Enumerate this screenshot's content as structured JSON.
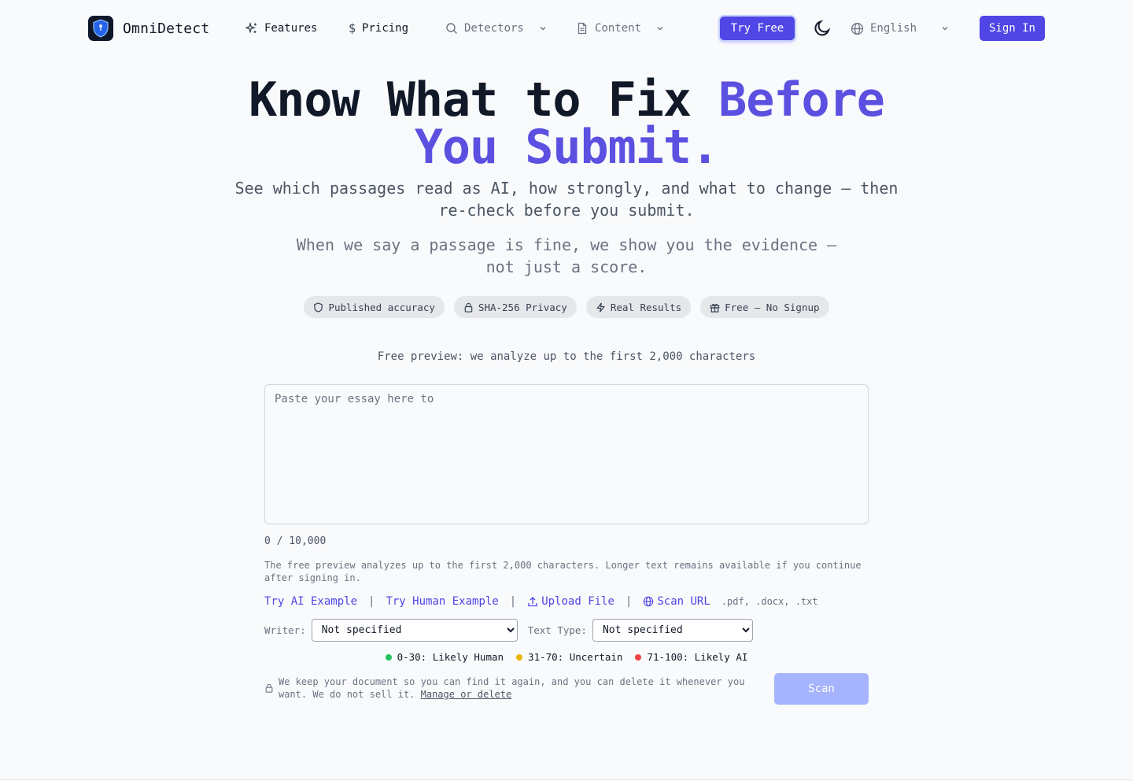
{
  "nav": {
    "brand": "OmniDetect",
    "features": "Features",
    "pricing": "Pricing",
    "detectors": "Detectors",
    "content": "Content",
    "try_free": "Try Free",
    "language": "English",
    "sign_in": "Sign In"
  },
  "hero": {
    "title_plain": "Know What to Fix ",
    "title_accent_1": "Before",
    "title_accent_2": "You Submit.",
    "subtitle": "See which passages read as AI, how strongly, and what to change — then re-check before you submit.",
    "evidence": "When we say a passage is fine, we show you the evidence — not just a score."
  },
  "pills": {
    "accuracy": "Published accuracy",
    "privacy": "SHA-256 Privacy",
    "results": "Real Results",
    "free": "Free — No Signup"
  },
  "editor": {
    "preview_note": "Free preview: we analyze up to the first 2,000 characters",
    "placeholder": "Paste your essay here to",
    "counter": "0 / 10,000",
    "limit_note": "The free preview analyzes up to the first 2,000 characters. Longer text remains available if you continue after signing in."
  },
  "actions": {
    "try_ai": "Try AI Example",
    "try_human": "Try Human Example",
    "upload": "Upload File",
    "scan_url": "Scan URL",
    "formats": ".pdf, .docx, .txt",
    "separator": "|"
  },
  "options": {
    "writer_label": "Writer:",
    "writer_value": "Not specified",
    "type_label": "Text Type:",
    "type_value": "Not specified"
  },
  "legend": {
    "human": "0-30: Likely Human",
    "uncertain": "31-70: Uncertain",
    "ai": "71-100: Likely AI",
    "colors": {
      "human": "#22c55e",
      "uncertain": "#eab308",
      "ai": "#ef4444"
    }
  },
  "privacy": {
    "text": "We keep your document so you can find it again, and you can delete it whenever you want. We do not sell it.",
    "link": "Manage or delete"
  },
  "scan_button": "Scan",
  "theme": {
    "accent": "#4f46e5",
    "accent_light": "#a5b4fc"
  }
}
